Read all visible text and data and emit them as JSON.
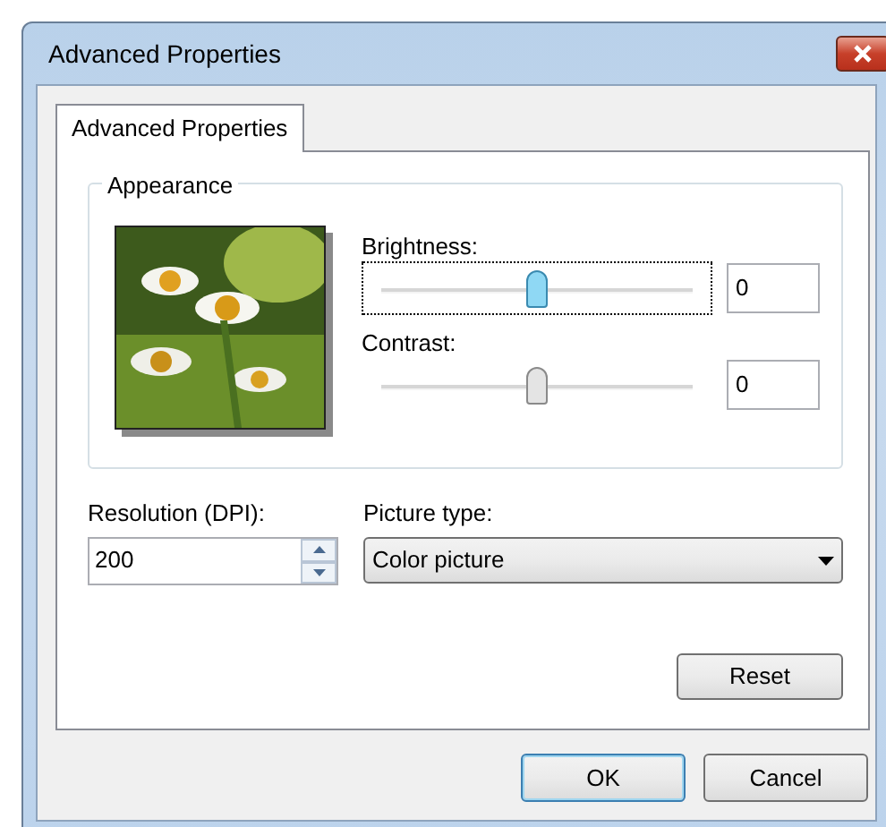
{
  "window": {
    "title": "Advanced Properties"
  },
  "tabs": [
    {
      "label": "Advanced Properties",
      "selected": true
    }
  ],
  "appearance": {
    "title": "Appearance",
    "sliders": [
      {
        "label": "Brightness:",
        "level": 0.5,
        "value": "0",
        "focused": true
      },
      {
        "label": "Contrast:",
        "level": 0.5,
        "value": "0",
        "focused": false
      }
    ]
  },
  "resolution": {
    "label": "Resolution (DPI):",
    "value": "200"
  },
  "picture_type": {
    "label": "Picture type:",
    "value": "Color picture"
  },
  "reset_button": "Reset",
  "buttons": [
    {
      "label": "OK",
      "default": true
    },
    {
      "label": "Cancel",
      "default": false
    }
  ]
}
